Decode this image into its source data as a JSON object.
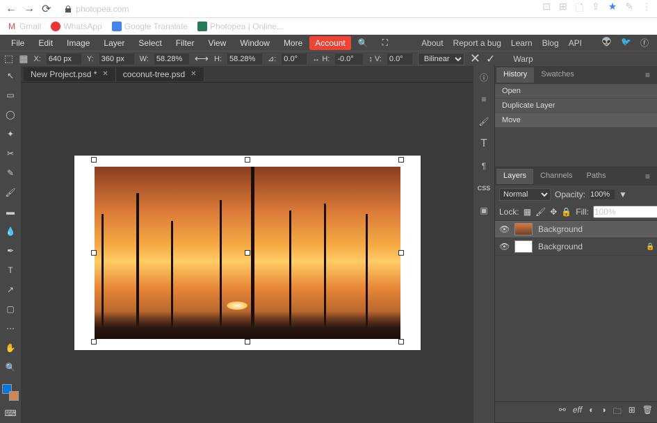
{
  "browser": {
    "url": "photopea.com",
    "bookmarks": [
      {
        "label": "Gmail",
        "color": "#d44"
      },
      {
        "label": "WhatsApp",
        "color": "#2a2"
      },
      {
        "label": "Google Translate",
        "color": "#4285f4"
      },
      {
        "label": "Photopea | Online...",
        "color": "#2a7a5a"
      }
    ]
  },
  "menu": [
    "File",
    "Edit",
    "Image",
    "Layer",
    "Select",
    "Filter",
    "View",
    "Window",
    "More"
  ],
  "account": "Account",
  "menu_right": [
    "About",
    "Report a bug",
    "Learn",
    "Blog",
    "API"
  ],
  "options": {
    "x_lbl": "X:",
    "x": "640 px",
    "y_lbl": "Y:",
    "y": "360 px",
    "w_lbl": "W:",
    "w": "58.28%",
    "h_lbl": "H:",
    "h": "58.28%",
    "a_lbl": "⊿:",
    "a": "0.0°",
    "sh_lbl": "↔ H:",
    "sh": "-0.0°",
    "sv_lbl": "↕ V:",
    "sv": "0.0°",
    "interp": "Bilinear",
    "warp": "Warp"
  },
  "tabs": [
    {
      "label": "New Project.psd *",
      "active": true
    },
    {
      "label": "coconut-tree.psd",
      "active": false
    }
  ],
  "history": {
    "tabs": [
      "History",
      "Swatches"
    ],
    "items": [
      "Open",
      "Duplicate Layer",
      "Move"
    ]
  },
  "layers": {
    "tabs": [
      "Layers",
      "Channels",
      "Paths"
    ],
    "blend": "Normal",
    "opacity_lbl": "Opacity:",
    "opacity": "100%",
    "lock_lbl": "Lock:",
    "fill_lbl": "Fill:",
    "fill": "100%",
    "items": [
      {
        "name": "Background",
        "thumb": "img",
        "selected": true,
        "locked": false
      },
      {
        "name": "Background",
        "thumb": "white",
        "selected": false,
        "locked": true
      }
    ]
  }
}
